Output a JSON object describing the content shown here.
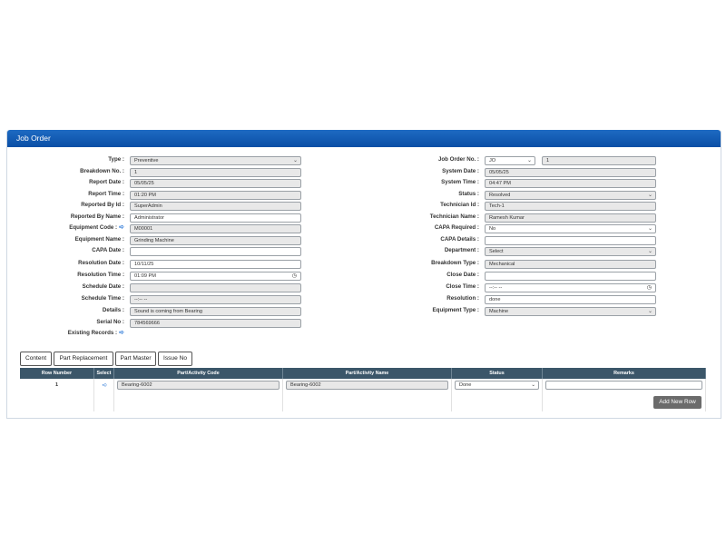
{
  "panel": {
    "title": "Job Order"
  },
  "left_form": [
    {
      "label": "Type :",
      "value": "Preventive",
      "kind": "select"
    },
    {
      "label": "Breakdown No. :",
      "value": "1",
      "kind": "readonly"
    },
    {
      "label": "Report Date :",
      "value": "05/05/25",
      "kind": "readonly"
    },
    {
      "label": "Report Time :",
      "value": "01:20 PM",
      "kind": "readonly"
    },
    {
      "label": "Reported By Id :",
      "value": "SuperAdmin",
      "kind": "readonly"
    },
    {
      "label": "Reported By Name :",
      "value": "Administrator",
      "kind": "white"
    },
    {
      "label": "Equipment Code :",
      "value": "M00001",
      "kind": "readonly",
      "arrow": true
    },
    {
      "label": "Equipment Name :",
      "value": "Grinding Machine",
      "kind": "readonly"
    },
    {
      "label": "CAPA Date :",
      "value": "",
      "kind": "white"
    },
    {
      "label": "Resolution Date :",
      "value": "10/11/25",
      "kind": "white"
    },
    {
      "label": "Resolution Time :",
      "value": "01:09 PM",
      "kind": "time"
    },
    {
      "label": "Schedule Date :",
      "value": "",
      "kind": "readonly"
    },
    {
      "label": "Schedule Time :",
      "value": "--:-- --",
      "kind": "readonly"
    },
    {
      "label": "Details :",
      "value": "Sound is coming from Bearing",
      "kind": "readonly"
    },
    {
      "label": "Serial No :",
      "value": "784569666",
      "kind": "readonly"
    },
    {
      "label": "Existing Records :",
      "value": "",
      "kind": "arrow-only"
    }
  ],
  "right_form": [
    {
      "label": "Job Order No. :",
      "prefix": "JO",
      "value": "1",
      "kind": "jo"
    },
    {
      "label": "System Date :",
      "value": "05/05/25",
      "kind": "readonly"
    },
    {
      "label": "System Time :",
      "value": "04:47 PM",
      "kind": "readonly"
    },
    {
      "label": "Status :",
      "value": "Resolved",
      "kind": "select"
    },
    {
      "label": "Technician Id :",
      "value": "Tech-1",
      "kind": "readonly"
    },
    {
      "label": "Technician Name :",
      "value": "Ramesh Kumar",
      "kind": "readonly"
    },
    {
      "label": "CAPA Required :",
      "value": "No",
      "kind": "select-white"
    },
    {
      "label": "CAPA Details :",
      "value": "",
      "kind": "white"
    },
    {
      "label": "Department :",
      "value": "Select",
      "kind": "select"
    },
    {
      "label": "Breakdown Type :",
      "value": "Mechanical",
      "kind": "readonly"
    },
    {
      "label": "Close Date :",
      "value": "",
      "kind": "white"
    },
    {
      "label": "Close Time :",
      "value": "--:-- --",
      "kind": "time"
    },
    {
      "label": "Resolution :",
      "value": "done",
      "kind": "white"
    },
    {
      "label": "Equipment Type :",
      "value": "Machine",
      "kind": "select"
    }
  ],
  "tabs": [
    "Content",
    "Part Replacement",
    "Part Master",
    "Issue No"
  ],
  "table": {
    "headers": [
      "Row Number",
      "Select",
      "Part/Activity Code",
      "Part/Activity Name",
      "Status",
      "Remarks"
    ],
    "rows": [
      {
        "row_number": "1",
        "code": "Bearing-6002",
        "name": "Bearing-6002",
        "status": "Done",
        "remarks": ""
      }
    ],
    "add_button": "Add New Row"
  }
}
